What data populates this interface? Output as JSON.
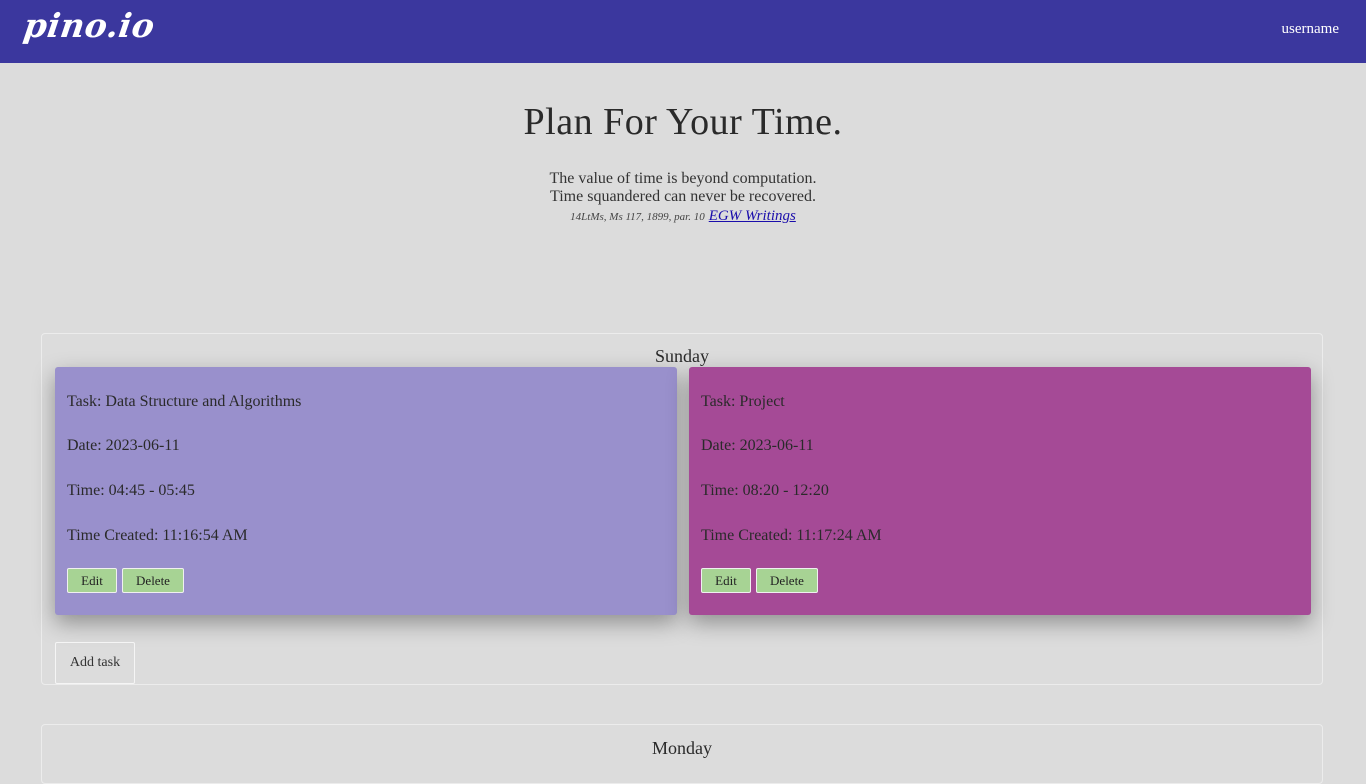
{
  "navbar": {
    "brand": "pino.io",
    "username": "username",
    "background": "#3b379e"
  },
  "hero": {
    "title": "Plan For Your Time.",
    "quote_line1": "The value of time is beyond computation.",
    "quote_line2": "Time squandered can never be recovered.",
    "citation": "14LtMs, Ms 117, 1899, par. 10",
    "source_link": "EGW Writings"
  },
  "days": [
    {
      "name": "Sunday",
      "tasks": [
        {
          "task": "Task: Data Structure and Algorithms",
          "date": "Date: 2023-06-11",
          "time": "Time: 04:45 - 05:45",
          "created": "Time Created: 11:16:54 AM",
          "edit_label": "Edit",
          "delete_label": "Delete",
          "color": "#9990cc"
        },
        {
          "task": "Task: Project",
          "date": "Date: 2023-06-11",
          "time": "Time: 08:20 - 12:20",
          "created": "Time Created: 11:17:24 AM",
          "edit_label": "Edit",
          "delete_label": "Delete",
          "color": "#a54a96"
        }
      ],
      "add_label": "Add task"
    },
    {
      "name": "Monday"
    }
  ],
  "colors": {
    "page_background": "#dcdcdc",
    "button_green": "#a7d394",
    "link": "#1a0dab"
  }
}
